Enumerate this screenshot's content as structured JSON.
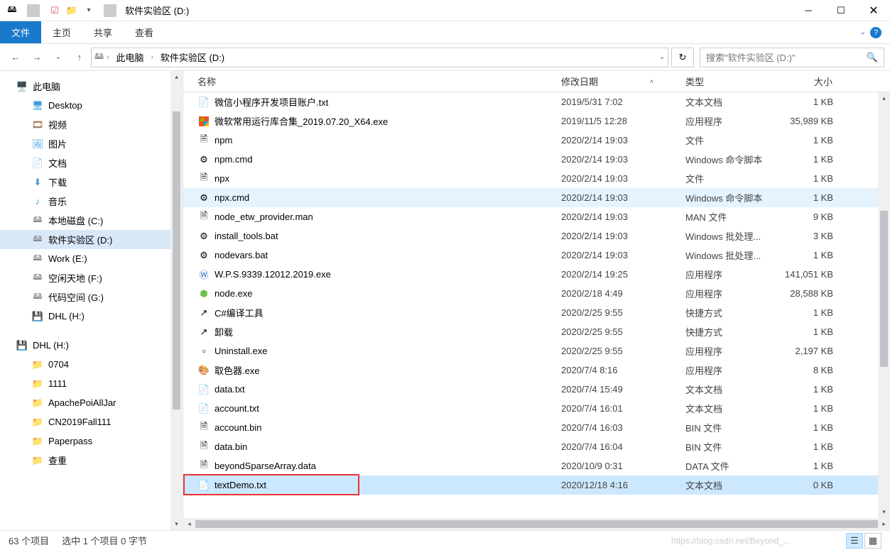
{
  "titlebar": {
    "title": "软件实验区 (D:)"
  },
  "ribbon": {
    "file": "文件",
    "home": "主页",
    "share": "共享",
    "view": "查看"
  },
  "breadcrumb": {
    "pc": "此电脑",
    "loc": "软件实验区 (D:)"
  },
  "search": {
    "placeholder": "搜索\"软件实验区 (D:)\""
  },
  "tree": [
    {
      "label": "此电脑",
      "icon": "pc",
      "depth": 0
    },
    {
      "label": "Desktop",
      "icon": "desktop",
      "depth": 1
    },
    {
      "label": "视频",
      "icon": "video",
      "depth": 1
    },
    {
      "label": "图片",
      "icon": "pic",
      "depth": 1
    },
    {
      "label": "文档",
      "icon": "doc",
      "depth": 1
    },
    {
      "label": "下载",
      "icon": "down",
      "depth": 1
    },
    {
      "label": "音乐",
      "icon": "music",
      "depth": 1
    },
    {
      "label": "本地磁盘 (C:)",
      "icon": "disk",
      "depth": 1
    },
    {
      "label": "软件实验区 (D:)",
      "icon": "disk",
      "depth": 1,
      "selected": true
    },
    {
      "label": "Work (E:)",
      "icon": "disk",
      "depth": 1
    },
    {
      "label": "空闲天地 (F:)",
      "icon": "disk",
      "depth": 1
    },
    {
      "label": "代码空间 (G:)",
      "icon": "disk",
      "depth": 1
    },
    {
      "label": "DHL (H:)",
      "icon": "sd",
      "depth": 1
    },
    {
      "label": "",
      "icon": "",
      "depth": 0
    },
    {
      "label": "DHL (H:)",
      "icon": "sd",
      "depth": 0
    },
    {
      "label": "0704",
      "icon": "folder",
      "depth": 1
    },
    {
      "label": "1111",
      "icon": "folder",
      "depth": 1
    },
    {
      "label": "ApachePoiAllJar",
      "icon": "folder",
      "depth": 1
    },
    {
      "label": "CN2019Fall111",
      "icon": "folder",
      "depth": 1
    },
    {
      "label": "Paperpass",
      "icon": "folder",
      "depth": 1
    },
    {
      "label": "查重",
      "icon": "folder",
      "depth": 1
    }
  ],
  "columns": {
    "name": "名称",
    "date": "修改日期",
    "type": "类型",
    "size": "大小"
  },
  "files": [
    {
      "name": "微信小程序开发项目账户.txt",
      "date": "2019/5/31 7:02",
      "type": "文本文档",
      "size": "1 KB",
      "icon": "txt"
    },
    {
      "name": "微软常用运行库合集_2019.07.20_X64.exe",
      "date": "2019/11/5 12:28",
      "type": "应用程序",
      "size": "35,989 KB",
      "icon": "msexe"
    },
    {
      "name": "npm",
      "date": "2020/2/14 19:03",
      "type": "文件",
      "size": "1 KB",
      "icon": "file"
    },
    {
      "name": "npm.cmd",
      "date": "2020/2/14 19:03",
      "type": "Windows 命令脚本",
      "size": "1 KB",
      "icon": "cmd"
    },
    {
      "name": "npx",
      "date": "2020/2/14 19:03",
      "type": "文件",
      "size": "1 KB",
      "icon": "file"
    },
    {
      "name": "npx.cmd",
      "date": "2020/2/14 19:03",
      "type": "Windows 命令脚本",
      "size": "1 KB",
      "icon": "cmd",
      "hover": true
    },
    {
      "name": "node_etw_provider.man",
      "date": "2020/2/14 19:03",
      "type": "MAN 文件",
      "size": "9 KB",
      "icon": "file"
    },
    {
      "name": "install_tools.bat",
      "date": "2020/2/14 19:03",
      "type": "Windows 批处理...",
      "size": "3 KB",
      "icon": "cmd"
    },
    {
      "name": "nodevars.bat",
      "date": "2020/2/14 19:03",
      "type": "Windows 批处理...",
      "size": "1 KB",
      "icon": "cmd"
    },
    {
      "name": "W.P.S.9339.12012.2019.exe",
      "date": "2020/2/14 19:25",
      "type": "应用程序",
      "size": "141,051 KB",
      "icon": "wps"
    },
    {
      "name": "node.exe",
      "date": "2020/2/18 4:49",
      "type": "应用程序",
      "size": "28,588 KB",
      "icon": "node"
    },
    {
      "name": "C#编译工具",
      "date": "2020/2/25 9:55",
      "type": "快捷方式",
      "size": "1 KB",
      "icon": "lnk"
    },
    {
      "name": "卸载",
      "date": "2020/2/25 9:55",
      "type": "快捷方式",
      "size": "1 KB",
      "icon": "lnk"
    },
    {
      "name": "Uninstall.exe",
      "date": "2020/2/25 9:55",
      "type": "应用程序",
      "size": "2,197 KB",
      "icon": "exe"
    },
    {
      "name": "取色器.exe",
      "date": "2020/7/4 8:16",
      "type": "应用程序",
      "size": "8 KB",
      "icon": "picker"
    },
    {
      "name": "data.txt",
      "date": "2020/7/4 15:49",
      "type": "文本文档",
      "size": "1 KB",
      "icon": "txt"
    },
    {
      "name": "account.txt",
      "date": "2020/7/4 16:01",
      "type": "文本文档",
      "size": "1 KB",
      "icon": "txt"
    },
    {
      "name": "account.bin",
      "date": "2020/7/4 16:03",
      "type": "BIN 文件",
      "size": "1 KB",
      "icon": "file"
    },
    {
      "name": "data.bin",
      "date": "2020/7/4 16:04",
      "type": "BIN 文件",
      "size": "1 KB",
      "icon": "file"
    },
    {
      "name": "beyondSparseArray.data",
      "date": "2020/10/9 0:31",
      "type": "DATA 文件",
      "size": "1 KB",
      "icon": "file"
    },
    {
      "name": "textDemo.txt",
      "date": "2020/12/18 4:16",
      "type": "文本文档",
      "size": "0 KB",
      "icon": "txt",
      "selected": true,
      "redbox": true
    }
  ],
  "status": {
    "count": "63 个项目",
    "selection": "选中 1 个项目 0 字节",
    "watermark": "https://blog.csdn.net/Beyond_..."
  }
}
